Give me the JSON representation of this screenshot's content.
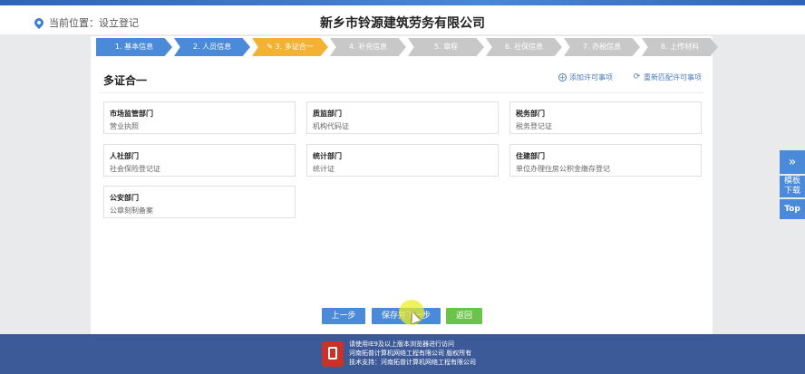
{
  "header": {
    "location_label": "当前位置：设立登记",
    "company_name": "新乡市铃源建筑劳务有限公司"
  },
  "steps": [
    {
      "label": "1. 基本信息",
      "state": "done"
    },
    {
      "label": "2. 人员信息",
      "state": "done"
    },
    {
      "label": "3. 多证合一",
      "state": "active"
    },
    {
      "label": "4. 补充信息",
      "state": "todo"
    },
    {
      "label": "5. 章程",
      "state": "todo"
    },
    {
      "label": "6. 社保信息",
      "state": "todo"
    },
    {
      "label": "7. 办税信息",
      "state": "todo"
    },
    {
      "label": "8. 上传材料",
      "state": "todo"
    }
  ],
  "section": {
    "title": "多证合一",
    "add_permit_link": "添加许可事项",
    "rematch_permit_link": "重新匹配许可事项"
  },
  "departments": [
    {
      "name": "市场监管部门",
      "cert": "营业执照"
    },
    {
      "name": "质监部门",
      "cert": "机构代码证"
    },
    {
      "name": "税务部门",
      "cert": "税务登记证"
    },
    {
      "name": "人社部门",
      "cert": "社会保险登记证"
    },
    {
      "name": "统计部门",
      "cert": "统计证"
    },
    {
      "name": "住建部门",
      "cert": "单位办理住房公积金缴存登记"
    },
    {
      "name": "公安部门",
      "cert": "公章刻制备案"
    }
  ],
  "buttons": {
    "prev": "上一步",
    "save_next": "保存并下一步",
    "back": "返回"
  },
  "side_tools": {
    "template_line1": "模板",
    "template_line2": "下载",
    "top": "Top"
  },
  "footer": {
    "line1": "请使用IE9及以上版本浏览器进行访问",
    "line2": "河南拓普计算机网络工程有限公司 版权所有",
    "line3": "技术支持：河南拓普计算机网络工程有限公司"
  },
  "colors": {
    "step_done": "#4a8ad8",
    "step_active": "#f3b234",
    "step_todo": "#c8c8c8",
    "footer": "#3d5a98",
    "btn_back": "#6cc24a"
  }
}
